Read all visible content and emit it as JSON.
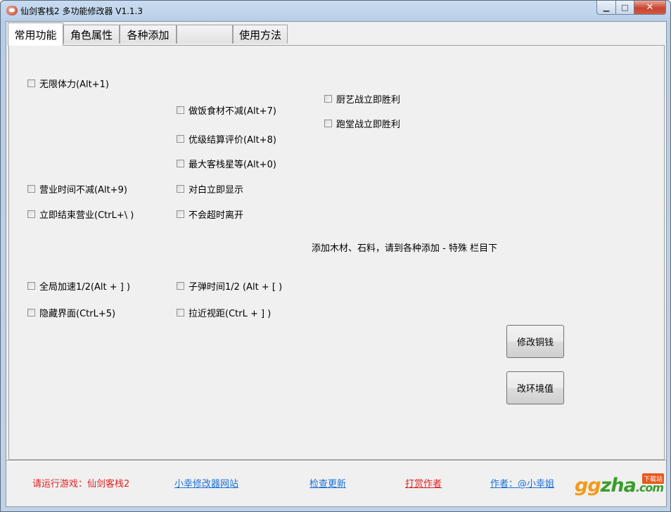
{
  "window": {
    "title": "仙剑客栈2 多功能修改器  V1.1.3"
  },
  "tabs": [
    "常用功能",
    "角色属性",
    "各种添加",
    "",
    "使用方法"
  ],
  "checkboxes": {
    "infinite_stamina": "无限体力(Alt+1)",
    "no_ingredient_loss": "做饭食材不减(Alt+7)",
    "superior_rating": "优级结算评价(Alt+8)",
    "max_inn_stars": "最大客栈星等(Alt+0)",
    "business_time_freeze": "营业时间不减(Alt+9)",
    "instant_dialogue": "对白立即显示",
    "end_business_now": "立即结束营业(CtrL+\\ )",
    "no_timeout_leave": "不会超时离开",
    "cooking_battle_win": "厨艺战立即胜利",
    "running_battle_win": "跑堂战立即胜利",
    "global_speed": "全局加速1/2(Alt + ] )",
    "bullet_time": "子弹时间1/2 (Alt + [ )",
    "hide_ui": "隐藏界面(CtrL+5)",
    "zoom_in": "拉近视距(CtrL + ] )"
  },
  "note": "添加木材、石料，请到各种添加 - 特殊 栏目下",
  "buttons": {
    "modify_money": "修改铜钱",
    "modify_env": "改环境值"
  },
  "footer": {
    "run_game": "请运行游戏：仙剑客栈2",
    "website": "小幸修改器网站",
    "check_update": "检查更新",
    "donate": "打赏作者",
    "author": "作者：@小幸姐"
  },
  "watermark": {
    "text_g": "gg",
    "text_z": "zha",
    "text_com": ".com",
    "tag": "下载站"
  }
}
